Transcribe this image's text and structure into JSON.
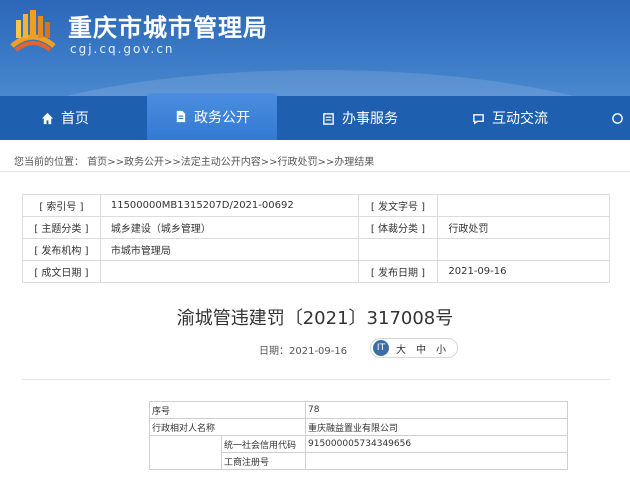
{
  "header": {
    "site_title": "重庆市城市管理局",
    "site_url": "cgj.cq.gov.cn",
    "colors": {
      "primary": "#1f5fb0",
      "active": "#3479d2"
    }
  },
  "nav": {
    "items": [
      {
        "label": "首页",
        "icon": "home-icon"
      },
      {
        "label": "政务公开",
        "icon": "document-icon",
        "active": true
      },
      {
        "label": "办事服务",
        "icon": "service-icon"
      },
      {
        "label": "互动交流",
        "icon": "chat-icon"
      }
    ]
  },
  "breadcrumb": {
    "prefix": "您当前的位置：",
    "items": [
      "首页",
      "政务公开",
      "法定主动公开内容",
      "行政处罚",
      "办理结果"
    ],
    "sep": ">>"
  },
  "meta": {
    "index_no_label": "[ 索引号 ]",
    "index_no": "11500000MB1315207D/2021-00692",
    "doc_no_label": "[ 发文字号 ]",
    "doc_no": "",
    "topic_label": "[ 主题分类 ]",
    "topic": "城乡建设（城乡管理）",
    "genre_label": "[ 体裁分类 ]",
    "genre": "行政处罚",
    "issuer_label": "[ 发布机构 ]",
    "issuer": "市城市管理局",
    "created_label": "[ 成文日期 ]",
    "created": "",
    "published_label": "[ 发布日期 ]",
    "published": "2021-09-16"
  },
  "doc": {
    "title": "渝城管违建罚〔2021〕317008号",
    "date_text": "日期：2021-09-16",
    "font_sizes": [
      "大",
      "中",
      "小"
    ]
  },
  "detail": {
    "rows": [
      {
        "label": "序号",
        "value": "78"
      },
      {
        "label": "行政相对人名称",
        "value": "重庆融益置业有限公司"
      },
      {
        "sub": "统一社会信用代码",
        "value": "915000005734349656"
      },
      {
        "sub": "工商注册号",
        "value": ""
      }
    ]
  }
}
